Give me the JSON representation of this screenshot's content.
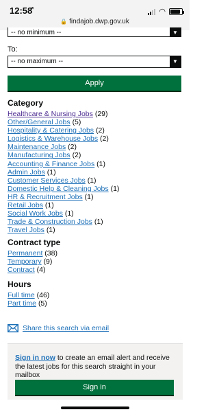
{
  "status": {
    "time": "12:58",
    "url": "findajob.dwp.gov.uk"
  },
  "filters": {
    "min_select": "-- no minimum --",
    "to_label": "To:",
    "max_select": "-- no maximum --",
    "apply_label": "Apply"
  },
  "category": {
    "heading": "Category",
    "items": [
      {
        "label": "Healthcare & Nursing Jobs",
        "count": "(29)"
      },
      {
        "label": "Other/General Jobs",
        "count": "(5)"
      },
      {
        "label": "Hospitality & Catering Jobs",
        "count": "(2)"
      },
      {
        "label": "Logistics & Warehouse Jobs",
        "count": "(2)"
      },
      {
        "label": "Maintenance Jobs",
        "count": "(2)"
      },
      {
        "label": "Manufacturing Jobs",
        "count": "(2)"
      },
      {
        "label": "Accounting & Finance Jobs",
        "count": "(1)"
      },
      {
        "label": "Admin Jobs",
        "count": "(1)"
      },
      {
        "label": "Customer Services Jobs",
        "count": "(1)"
      },
      {
        "label": "Domestic Help & Cleaning Jobs",
        "count": "(1)"
      },
      {
        "label": "HR & Recruitment Jobs",
        "count": "(1)"
      },
      {
        "label": "Retail Jobs",
        "count": "(1)"
      },
      {
        "label": "Social Work Jobs",
        "count": "(1)"
      },
      {
        "label": "Trade & Construction Jobs",
        "count": "(1)"
      },
      {
        "label": "Travel Jobs",
        "count": "(1)"
      }
    ]
  },
  "contract": {
    "heading": "Contract type",
    "items": [
      {
        "label": "Permanent",
        "count": "(38)"
      },
      {
        "label": "Temporary",
        "count": "(9)"
      },
      {
        "label": "Contract",
        "count": "(4)"
      }
    ]
  },
  "hours": {
    "heading": "Hours",
    "items": [
      {
        "label": "Full time",
        "count": "(46)"
      },
      {
        "label": "Part time",
        "count": "(5)"
      }
    ]
  },
  "share": {
    "label": "Share this search via email"
  },
  "signin": {
    "link": "Sign in now",
    "text": " to create an email alert and receive the latest jobs for this search straight in your mailbox",
    "button": "Sign in"
  },
  "colors": {
    "link": "#1d70b8",
    "visited": "#4c2c92",
    "button": "#00703c"
  }
}
